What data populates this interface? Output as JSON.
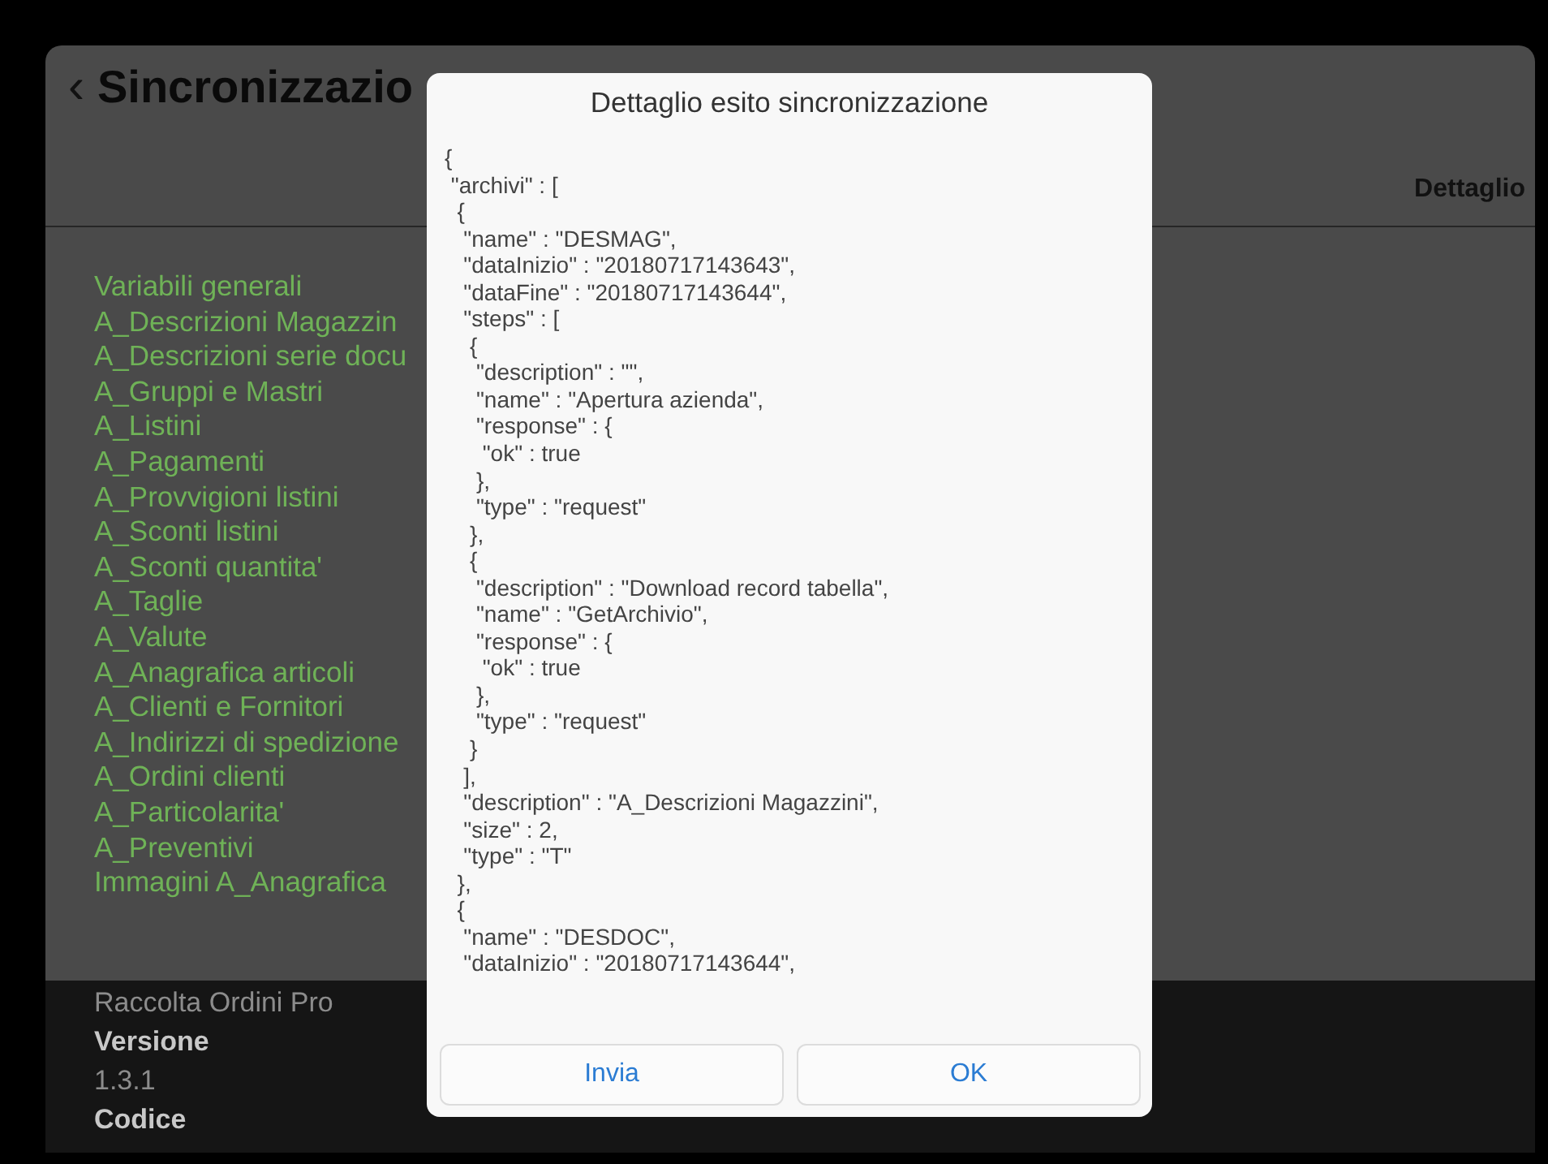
{
  "screen": {
    "back_icon": "‹",
    "title": "Sincronizzazio",
    "header_action": "Dettaglio",
    "items": [
      "Variabili generali",
      "A_Descrizioni Magazzin",
      "A_Descrizioni serie docu",
      "A_Gruppi e Mastri",
      "A_Listini",
      "A_Pagamenti",
      "A_Provvigioni listini",
      "A_Sconti listini",
      "A_Sconti quantita'",
      "A_Taglie",
      "A_Valute",
      "A_Anagrafica articoli",
      "A_Clienti e Fornitori",
      "A_Indirizzi di spedizione",
      "A_Ordini clienti",
      "A_Particolarita'",
      "A_Preventivi",
      "Immagini A_Anagrafica"
    ],
    "footer": [
      {
        "kind": "caption",
        "text": "Raccolta Ordini Pro"
      },
      {
        "kind": "heading",
        "text": "Versione"
      },
      {
        "kind": "value",
        "text": "1.3.1"
      },
      {
        "kind": "heading",
        "text": "Codice"
      }
    ]
  },
  "dialog": {
    "title": "Dettaglio esito sincronizzazione",
    "lines": [
      "{",
      " \"archivi\" : [",
      "  {",
      "   \"name\" : \"DESMAG\",",
      "   \"dataInizio\" : \"20180717143643\",",
      "   \"dataFine\" : \"20180717143644\",",
      "   \"steps\" : [",
      "    {",
      "     \"description\" : \"\",",
      "     \"name\" : \"Apertura azienda\",",
      "     \"response\" : {",
      "      \"ok\" : true",
      "     },",
      "     \"type\" : \"request\"",
      "    },",
      "    {",
      "     \"description\" : \"Download record tabella\",",
      "     \"name\" : \"GetArchivio\",",
      "     \"response\" : {",
      "      \"ok\" : true",
      "     },",
      "     \"type\" : \"request\"",
      "    }",
      "   ],",
      "   \"description\" : \"A_Descrizioni Magazzini\",",
      "   \"size\" : 2,",
      "   \"type\" : \"T\"",
      "  },",
      "  {",
      "   \"name\" : \"DESDOC\",",
      "   \"dataInizio\" : \"20180717143644\","
    ],
    "buttons": [
      "Invia",
      "OK"
    ]
  }
}
